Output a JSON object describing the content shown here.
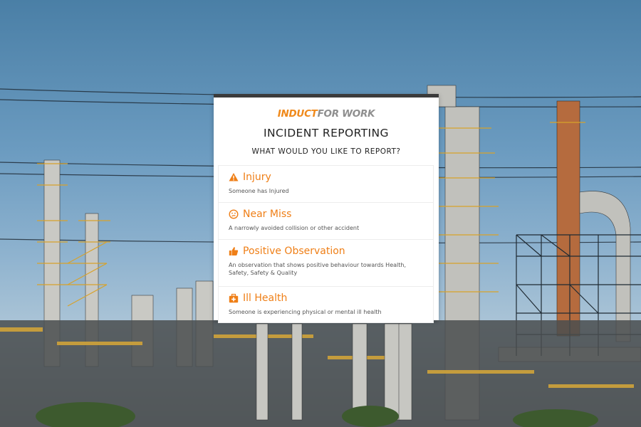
{
  "brand": {
    "logo_part1": "INDUCT",
    "logo_part2": "FOR WORK",
    "accent_color": "#ef7f17"
  },
  "page": {
    "title": "INCIDENT REPORTING",
    "subtitle": "WHAT WOULD YOU LIKE TO REPORT?"
  },
  "options": [
    {
      "icon": "warning-icon",
      "label": "Injury",
      "description": "Someone has Injured"
    },
    {
      "icon": "confused-face-icon",
      "label": "Near Miss",
      "description": "A narrowly avoided collision or other accident"
    },
    {
      "icon": "thumbs-up-icon",
      "label": "Positive Observation",
      "description": "An observation that shows positive behaviour towards Health, Safety, Safety & Quality"
    },
    {
      "icon": "first-aid-kit-icon",
      "label": "Ill Health",
      "description": "Someone is experiencing physical or mental ill health"
    }
  ]
}
